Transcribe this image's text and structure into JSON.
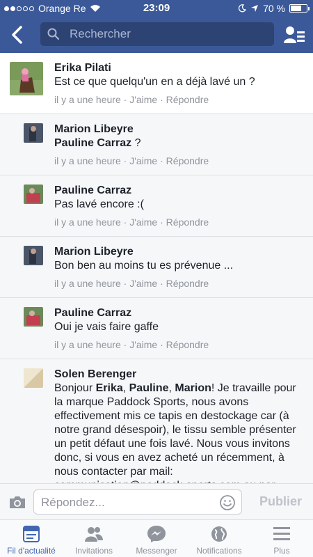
{
  "status_bar": {
    "carrier": "Orange Re",
    "time": "23:09",
    "battery": "70 %",
    "battery_level": 0.7
  },
  "navbar": {
    "search_placeholder": "Rechercher",
    "back_icon": "chevron-left-icon",
    "profile_icon": "friends-list-icon"
  },
  "comments": [
    {
      "author": "Erika Pilati",
      "text": "Est ce que quelqu'un en a déjà lavé un ?",
      "time": "il y a une heure",
      "like": "J'aime",
      "reply": "Répondre"
    },
    {
      "author": "Marion Libeyre",
      "mention": "Pauline Carraz",
      "text": " ?",
      "time": "il y a une heure",
      "like": "J'aime",
      "reply": "Répondre"
    },
    {
      "author": "Pauline Carraz",
      "text": "Pas lavé encore :(",
      "time": "il y a une heure",
      "like": "J'aime",
      "reply": "Répondre"
    },
    {
      "author": "Marion Libeyre",
      "text": "Bon ben au moins tu es prévenue ...",
      "time": "il y a une heure",
      "like": "J'aime",
      "reply": "Répondre"
    },
    {
      "author": "Pauline Carraz",
      "text": "Oui je vais faire gaffe",
      "time": "il y a une heure",
      "like": "J'aime",
      "reply": "Répondre"
    },
    {
      "author": "Solen Berenger",
      "text_parts": {
        "p1": "Bonjour ",
        "m1": "Erika",
        "p2": ", ",
        "m2": "Pauline",
        "p3": ", ",
        "m3": "Marion",
        "p4": "! Je travaille pour la marque Paddock Sports, nous avons effectivement mis ce tapis en destockage car (à notre grand désespoir), le tissu semble présenter un petit défaut une fois lavé. Nous vous invitons donc, si vous en avez acheté un récemment, à nous contacter par mail: communication@paddock-sports.com ou par"
      }
    }
  ],
  "composer": {
    "placeholder": "Répondez...",
    "publish": "Publier"
  },
  "tabs": [
    {
      "label": "Fil d'actualité",
      "icon": "news-feed-icon",
      "active": true
    },
    {
      "label": "Invitations",
      "icon": "friend-requests-icon"
    },
    {
      "label": "Messenger",
      "icon": "messenger-icon"
    },
    {
      "label": "Notifications",
      "icon": "globe-icon"
    },
    {
      "label": "Plus",
      "icon": "menu-icon"
    }
  ],
  "colors": {
    "brand": "#3b5998",
    "active_tab": "#4267b2",
    "meta_text": "#90949c"
  }
}
